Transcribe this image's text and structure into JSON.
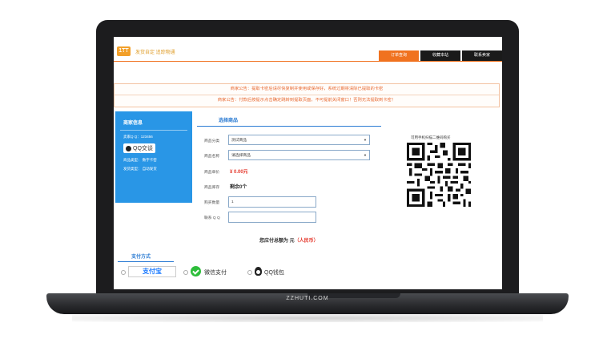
{
  "header": {
    "logo_mark": "1TT",
    "logo_sub": "wwwk.com",
    "logo_text": "发货自定 追踪物通",
    "nav": [
      {
        "label": "订单查询"
      },
      {
        "label": "收藏本站"
      },
      {
        "label": "联系卖家"
      }
    ]
  },
  "notices": [
    "商家公告：提取卡密后请尽快复制并使用或保存好，系统过期将清除已提取的卡密",
    "商家公告：付款后按提示点击确定跳转到提取页面，不可提前关闭窗口！否则无法提取到卡密！"
  ],
  "merchant": {
    "title": "商家信息",
    "seller_qq": "卖家Q Q：123456",
    "qq_button": "QQ交谈",
    "product_type": "商品类型：  数字卡密",
    "delivery_type": "发货类型：  自动发货"
  },
  "order": {
    "title": "选择商品",
    "category_label": "商品分类",
    "category_value": "测试商品",
    "name_label": "商品名称",
    "name_value": "请选择商品",
    "price_label": "商品单价",
    "price_value": "¥ 0.00元",
    "stock_label": "商品库存",
    "stock_value": "剩余0个",
    "qty_label": "购买数量",
    "qty_value": "1",
    "contact_label": "联系 Q Q",
    "contact_value": "",
    "total_prefix": "您应付总额为 元",
    "total_currency": "（人民币）"
  },
  "qr": {
    "caption": "可用手机扫描二维码购买"
  },
  "payment": {
    "title": "支付方式",
    "alipay": "支付宝",
    "wechat": "微信支付",
    "qqwallet": "QQ钱包"
  },
  "device": {
    "brand": "ZZHUTI.COM"
  },
  "colors": {
    "accent": "#f0721f",
    "nav_dark": "#1a1a1a",
    "merchant_blue": "#2996e6",
    "notice_text": "#e86a32",
    "price": "#e53a2e"
  }
}
